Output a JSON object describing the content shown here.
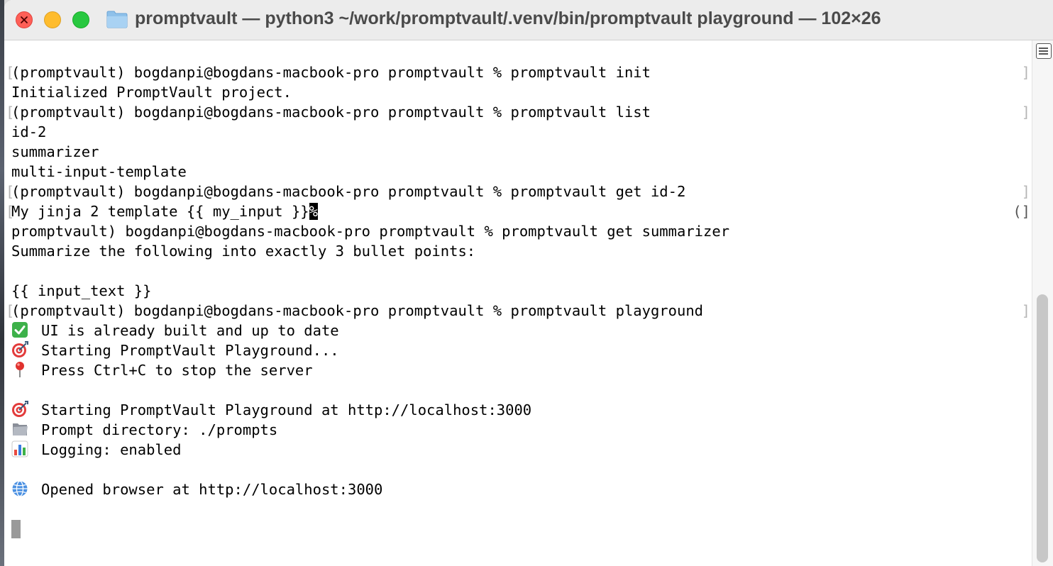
{
  "window": {
    "title": "promptvault — python3 ~/work/promptvault/.venv/bin/promptvault playground — 102×26",
    "icons": {
      "close": "close-icon",
      "minimize": "minimize-icon",
      "maximize": "maximize-icon",
      "folder": "folder-icon"
    },
    "colors": {
      "close": "#ff5f57",
      "minimize": "#febc2e",
      "maximize": "#28c840"
    }
  },
  "terminal": {
    "lines": [
      {
        "text": "",
        "left_mark": "",
        "right_mark": ""
      },
      {
        "text": "(promptvault) bogdanpi@bogdans-macbook-pro promptvault % promptvault init",
        "left_mark": "[",
        "right_mark": "]"
      },
      {
        "text": "Initialized PromptVault project.",
        "left_mark": "",
        "right_mark": ""
      },
      {
        "text": "(promptvault) bogdanpi@bogdans-macbook-pro promptvault % promptvault list",
        "left_mark": "[",
        "right_mark": "]"
      },
      {
        "text": "id-2",
        "left_mark": "",
        "right_mark": ""
      },
      {
        "text": "summarizer",
        "left_mark": "",
        "right_mark": ""
      },
      {
        "text": "multi-input-template",
        "left_mark": "",
        "right_mark": ""
      },
      {
        "text": "(promptvault) bogdanpi@bogdans-macbook-pro promptvault % promptvault get id-2",
        "left_mark": "[",
        "right_mark": "]"
      },
      {
        "text": "My jinja 2 template {{ my_input }}",
        "inline_cursor": "%",
        "left_mark": "[",
        "right_mark": "(]"
      },
      {
        "text": "promptvault) bogdanpi@bogdans-macbook-pro promptvault % promptvault get summarizer",
        "left_mark": "",
        "right_mark": ""
      },
      {
        "text": "Summarize the following into exactly 3 bullet points:",
        "left_mark": "",
        "right_mark": ""
      },
      {
        "text": "",
        "left_mark": "",
        "right_mark": ""
      },
      {
        "text": "{{ input_text }}",
        "left_mark": "",
        "right_mark": ""
      },
      {
        "text": "(promptvault) bogdanpi@bogdans-macbook-pro promptvault % promptvault playground",
        "left_mark": "[",
        "right_mark": "]"
      },
      {
        "emoji": "check-icon",
        "text": "UI is already built and up to date",
        "left_mark": "",
        "right_mark": ""
      },
      {
        "emoji": "target-icon",
        "text": "Starting PromptVault Playground...",
        "left_mark": "",
        "right_mark": ""
      },
      {
        "emoji": "pin-icon",
        "text": "Press Ctrl+C to stop the server",
        "left_mark": "",
        "right_mark": ""
      },
      {
        "text": "",
        "left_mark": "",
        "right_mark": ""
      },
      {
        "emoji": "target-icon",
        "text": "Starting PromptVault Playground at http://localhost:3000",
        "left_mark": "",
        "right_mark": ""
      },
      {
        "emoji": "folder-icon",
        "text": "Prompt directory: ./prompts",
        "left_mark": "",
        "right_mark": ""
      },
      {
        "emoji": "chart-icon",
        "text": "Logging: enabled",
        "left_mark": "",
        "right_mark": ""
      },
      {
        "text": "",
        "left_mark": "",
        "right_mark": ""
      },
      {
        "emoji": "globe-icon",
        "text": "Opened browser at http://localhost:3000",
        "left_mark": "",
        "right_mark": ""
      }
    ]
  }
}
